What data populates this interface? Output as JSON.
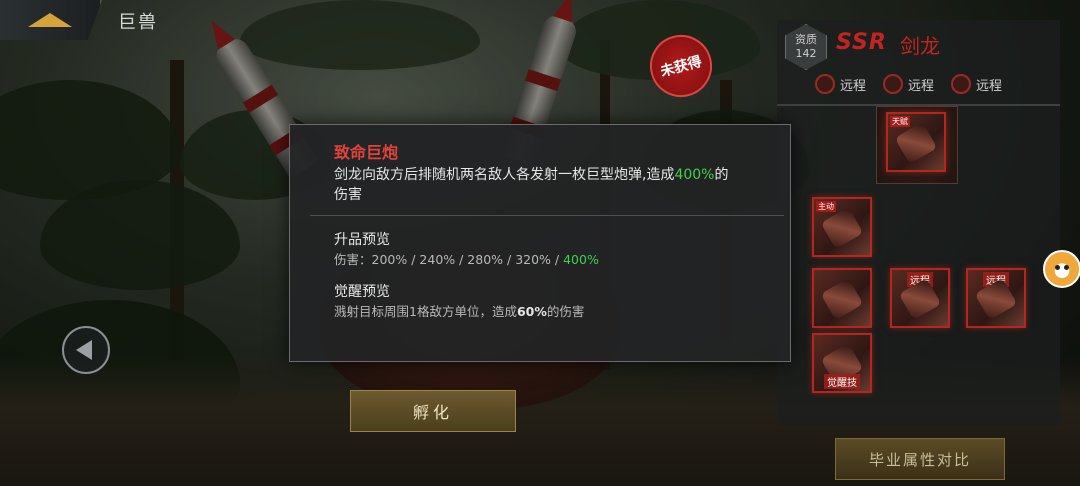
{
  "header": {
    "title": "巨兽"
  },
  "stamp": {
    "text": "未获得"
  },
  "hatch_button": {
    "label": "孵化"
  },
  "compare_button": {
    "label": "毕业属性对比"
  },
  "dino": {
    "quality_label": "资质",
    "quality_value": "142",
    "rarity": "SSR",
    "name": "剑龙"
  },
  "skill_tags": [
    {
      "label": "远程"
    },
    {
      "label": "远程"
    },
    {
      "label": "远程"
    }
  ],
  "skill_cards": {
    "main_label": "天赋",
    "active_label": "主动",
    "ranged_1": "远程",
    "ranged_2": "远程",
    "awaken": "觉醒技"
  },
  "tooltip": {
    "title": "致命巨炮",
    "desc_part1": "剑龙向敌方后排随机两名敌人各发射一枚巨型炮弹,造成",
    "desc_value": "400%",
    "desc_part2": "的伤害",
    "upgrade_heading": "升品预览",
    "upgrade_prefix": "伤害：",
    "upgrade_values": "200% / 240% / 280% / 320% / ",
    "upgrade_max": "400%",
    "awaken_heading": "觉醒预览",
    "awaken_prefix": "溅射目标周围1格敌方单位，造成",
    "awaken_value": "60%",
    "awaken_suffix": "的伤害"
  },
  "colors": {
    "accent_red": "#e0433a",
    "highlight_green": "#42d14a",
    "gold": "#d6a23a"
  }
}
